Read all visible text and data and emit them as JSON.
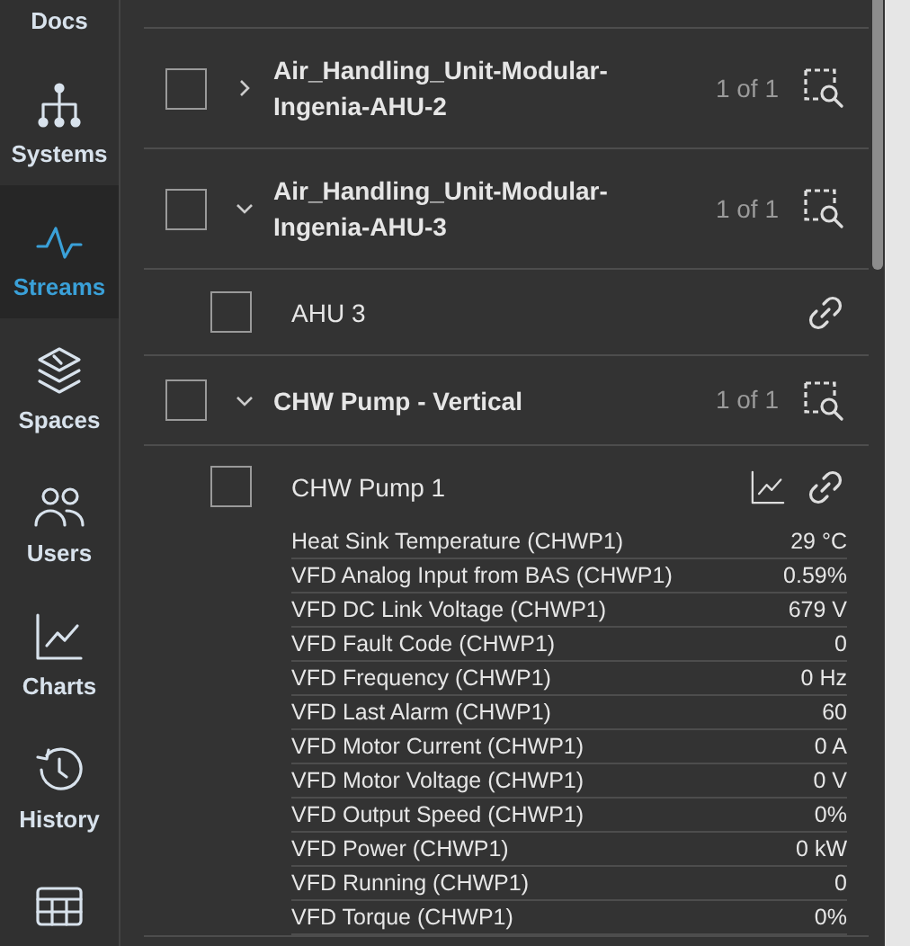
{
  "sidebar": {
    "items": [
      {
        "label": "Docs",
        "selected": false
      },
      {
        "label": "Systems",
        "selected": false
      },
      {
        "label": "Streams",
        "selected": true
      },
      {
        "label": "Spaces",
        "selected": false
      },
      {
        "label": "Users",
        "selected": false
      },
      {
        "label": "Charts",
        "selected": false
      },
      {
        "label": "History",
        "selected": false
      },
      {
        "selected": false
      }
    ]
  },
  "groups": [
    {
      "title": "Air_Handling_Unit-Modular-Ingenia-AHU-2",
      "count": "1 of 1",
      "checked": false,
      "expanded": false
    },
    {
      "title": "Air_Handling_Unit-Modular-Ingenia-AHU-3",
      "count": "1 of 1",
      "checked": false,
      "expanded": true,
      "children": [
        {
          "name": "AHU 3",
          "checked": false
        }
      ]
    },
    {
      "title": "CHW Pump - Vertical",
      "count": "1 of 1",
      "checked": false,
      "expanded": true,
      "children": [
        {
          "name": "CHW Pump 1",
          "checked": false,
          "readings": [
            {
              "label": "Heat Sink Temperature (CHWP1)",
              "value": "29 °C"
            },
            {
              "label": "VFD Analog Input from BAS (CHWP1)",
              "value": "0.59%"
            },
            {
              "label": "VFD DC Link Voltage (CHWP1)",
              "value": "679 V"
            },
            {
              "label": "VFD Fault Code (CHWP1)",
              "value": "0"
            },
            {
              "label": "VFD Frequency (CHWP1)",
              "value": "0 Hz"
            },
            {
              "label": "VFD Last Alarm (CHWP1)",
              "value": "60"
            },
            {
              "label": "VFD Motor Current (CHWP1)",
              "value": "0 A"
            },
            {
              "label": "VFD Motor Voltage (CHWP1)",
              "value": "0 V"
            },
            {
              "label": "VFD Output Speed (CHWP1)",
              "value": "0%"
            },
            {
              "label": "VFD Power (CHWP1)",
              "value": "0 kW"
            },
            {
              "label": "VFD Running (CHWP1)",
              "value": "0"
            },
            {
              "label": "VFD Torque (CHWP1)",
              "value": "0%"
            }
          ]
        }
      ]
    }
  ]
}
